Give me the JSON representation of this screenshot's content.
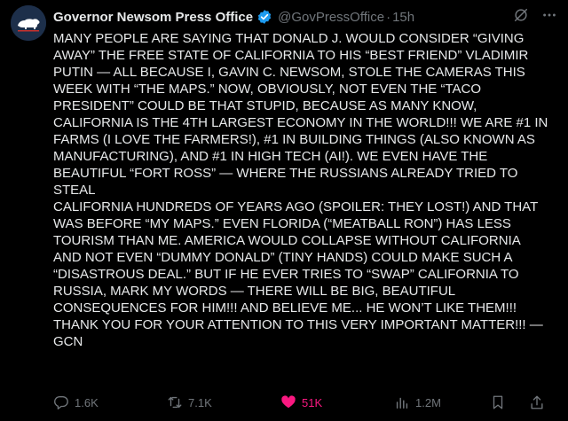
{
  "post": {
    "author_name": "Governor Newsom Press Office",
    "handle": "@GovPressOffice",
    "separator": "·",
    "time": "15h",
    "text": "MANY PEOPLE ARE SAYING THAT DONALD J. WOULD CONSIDER “GIVING\nAWAY” THE FREE STATE OF CALIFORNIA TO HIS “BEST FRIEND” VLADIMIR\nPUTIN — ALL BECAUSE I, GAVIN C. NEWSOM, STOLE THE CAMERAS THIS\nWEEK WITH “THE MAPS.” NOW, OBVIOUSLY, NOT EVEN THE “TACO\nPRESIDENT” COULD BE THAT STUPID, BECAUSE AS MANY KNOW,\nCALIFORNIA IS THE 4TH LARGEST ECONOMY IN THE WORLD!!! WE ARE #1 IN\nFARMS (I LOVE THE FARMERS!), #1 IN BUILDING THINGS (ALSO KNOWN AS\nMANUFACTURING), AND #1 IN HIGH TECH (AI!). WE EVEN HAVE THE\nBEAUTIFUL “FORT ROSS” — WHERE THE RUSSIANS ALREADY TRIED TO STEAL\nCALIFORNIA HUNDREDS OF YEARS AGO (SPOILER: THEY LOST!) AND THAT\nWAS BEFORE “MY MAPS.” EVEN FLORIDA (“MEATBALL RON”) HAS LESS\nTOURISM THAN ME. AMERICA WOULD COLLAPSE WITHOUT CALIFORNIA\nAND NOT EVEN “DUMMY DONALD” (TINY HANDS) COULD MAKE SUCH A\n“DISASTROUS DEAL.” BUT IF HE EVER TRIES TO “SWAP” CALIFORNIA TO\nRUSSIA, MARK MY WORDS — THERE WILL BE BIG, BEAUTIFUL\nCONSEQUENCES FOR HIM!!! AND BELIEVE ME... HE WON’T LIKE THEM!!!\nTHANK YOU FOR YOUR ATTENTION TO THIS VERY IMPORTANT MATTER!!! —\nGCN"
  },
  "metrics": {
    "replies": "1.6K",
    "reposts": "7.1K",
    "likes": "51K",
    "views": "1.2M"
  },
  "icons": {
    "avatar": "california-bear-icon",
    "verified": "verified-badge-icon",
    "grok": "grok-icon",
    "more": "more-icon",
    "reply": "reply-icon",
    "repost": "repost-icon",
    "like": "heart-icon",
    "views": "views-icon",
    "bookmark": "bookmark-icon",
    "share": "share-icon"
  },
  "colors": {
    "background": "#000000",
    "text": "#e7e9ea",
    "muted": "#71767b",
    "verified": "#1d9bf0",
    "like": "#f91880",
    "avatar_bg": "#1d2f4a"
  }
}
